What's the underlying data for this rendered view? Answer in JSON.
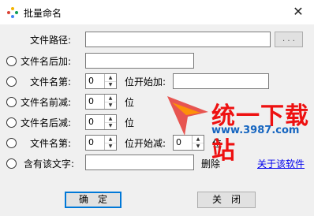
{
  "window": {
    "title": "批量命名",
    "close_glyph": "✕"
  },
  "form": {
    "path_label": "文件路径:",
    "browse_label": ". . .",
    "path_value": "",
    "row_add_suffix_label": "文件名后加:",
    "row_add_suffix_value": "",
    "row_insert_label": "文件名第:",
    "row_insert_pos": "0",
    "row_insert_mid": "位开始加:",
    "row_insert_value": "",
    "row_trim_front_label": "文件名前减:",
    "row_trim_front_value": "0",
    "row_trim_front_unit": "位",
    "row_trim_back_label": "文件名后减:",
    "row_trim_back_value": "0",
    "row_trim_back_unit": "位",
    "row_cut_label": "文件名第:",
    "row_cut_pos": "0",
    "row_cut_mid": "位开始减:",
    "row_cut_count": "0",
    "row_cut_unit": "位",
    "row_contains_label": "含有该文字:",
    "row_contains_value": "",
    "row_contains_action": "删除",
    "about_link": "关于该软件"
  },
  "buttons": {
    "ok": "确　定",
    "close": "关　闭"
  },
  "watermark": {
    "text": "统一下载站",
    "url": "www.3987.com"
  }
}
